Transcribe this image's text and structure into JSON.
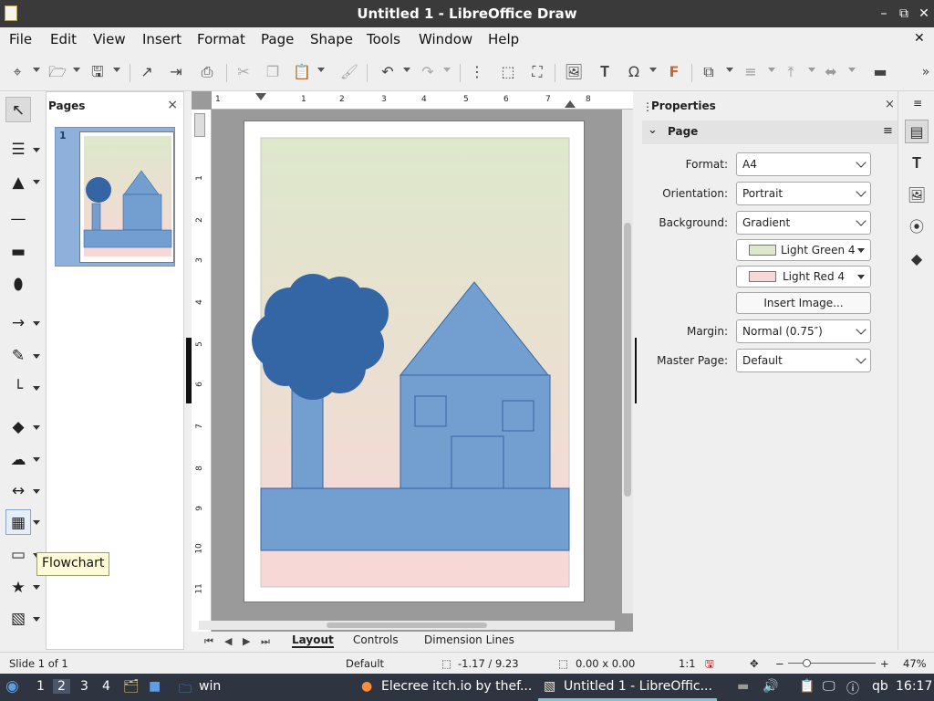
{
  "window": {
    "title": "Untitled 1 - LibreOffice Draw",
    "controls": [
      "–",
      "⧉",
      "✕"
    ]
  },
  "menu": {
    "items": [
      "File",
      "Edit",
      "View",
      "Insert",
      "Format",
      "Page",
      "Shape",
      "Tools",
      "Window",
      "Help"
    ],
    "close": "✕"
  },
  "pages_panel": {
    "title": "Pages",
    "close": "×",
    "page_number": "1"
  },
  "ruler": {
    "h": [
      "1",
      "1",
      "2",
      "3",
      "4",
      "5",
      "6",
      "7",
      "8"
    ],
    "v": [
      "1",
      "1",
      "2",
      "3",
      "4",
      "5",
      "6",
      "7",
      "8",
      "9",
      "10",
      "11"
    ]
  },
  "tooltip": "Flowchart",
  "tabs": [
    "Layout",
    "Controls",
    "Dimension Lines"
  ],
  "properties": {
    "title": "Properties",
    "close": "×",
    "section": "Page",
    "format_label": "Format:",
    "format_value": "A4",
    "orientation_label": "Orientation:",
    "orientation_value": "Portrait",
    "background_label": "Background:",
    "background_value": "Gradient",
    "color1": "Light Green 4",
    "color2": "Light Red 4",
    "insert_image": "Insert Image...",
    "margin_label": "Margin:",
    "margin_value": "Normal (0.75″)",
    "master_label": "Master Page:",
    "master_value": "Default"
  },
  "status": {
    "slide": "Slide 1 of 1",
    "layout": "Default",
    "position": "-1.17 / 9.23",
    "size": "0.00 x 0.00",
    "scale": "1:1",
    "zoom": "47%"
  },
  "taskbar": {
    "workspaces": [
      "1",
      "2",
      "3",
      "4"
    ],
    "win_label": "win",
    "task1": "Elecree itch.io by thef...",
    "task2": "Untitled 1 - LibreOffic...",
    "qb": "qb",
    "clock": "16:17"
  },
  "colors": {
    "light_green_4": "#dde8cb",
    "light_red_4": "#f8d7d7",
    "shape_blue": "#729fcf",
    "tree_blue": "#3465a4",
    "titlebar": "#3a3a3a",
    "taskbar": "#2e3440"
  }
}
